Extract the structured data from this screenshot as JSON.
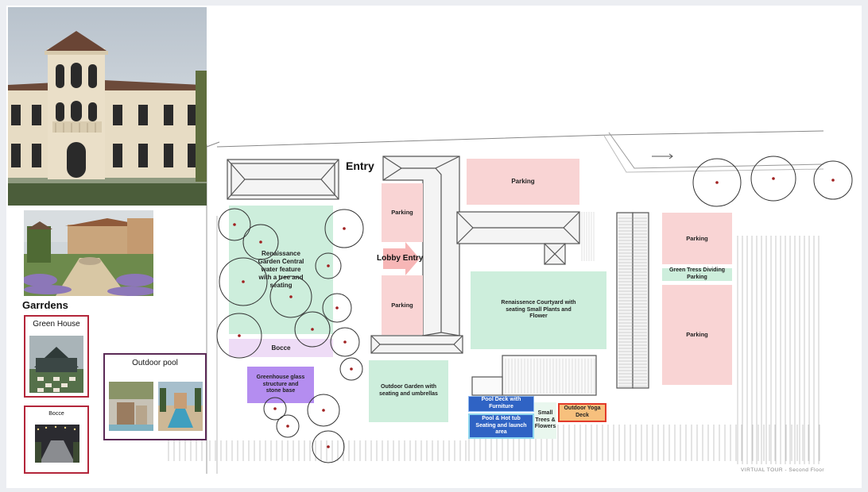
{
  "board": {
    "entry_label": "Entry",
    "lobby_entry_label": "Lobby Entry",
    "gardens_heading": "Garrdens",
    "green_house_label": "Green House",
    "bocce_photo_label": "Bocce",
    "outdoor_pool_label": "Outdoor pool",
    "footer_label": "VIRTUAL TOUR - Second Floor"
  },
  "zones": {
    "parking_top": "Parking",
    "parking_left_upper": "Parking",
    "parking_left_lower": "Parking",
    "parking_right_upper": "Parking",
    "green_trees_dividing": "Green Tress Dividing Parking",
    "parking_right_lower": "Parking",
    "renaissance_garden": "Renaissance Garden Central water feature with a tree and seating",
    "bocce": "Bocce",
    "greenhouse": "Greenhouse glass structure and stone base",
    "renaissance_courtyard": "Renaissence Courtyard with seating Small Plants and Flower",
    "outdoor_garden": "Outdoor Garden with seating and umbrellas",
    "pool_deck": "Pool Deck with Furniture",
    "pool_hot_tub": "Pool & Hot tub Seating and launch area",
    "small_trees": "Small Trees & Flowers",
    "yoga_deck": "Outdoor Yoga Deck"
  },
  "colors": {
    "parking": "#f9d4d4",
    "garden": "#cdeedc",
    "bocce": "#eedcf6",
    "greenhouse": "#b48df0",
    "pool": "#2f63c4",
    "yoga": "#f7c07d",
    "photo_border": "#b3263a",
    "pool_border": "#5b2a56"
  },
  "icons": [
    "tree-icon",
    "arrow-right-icon",
    "building-roof-icon",
    "villa-photo",
    "garden-photo",
    "greenhouse-photo",
    "bocce-photo",
    "pool-photo"
  ]
}
